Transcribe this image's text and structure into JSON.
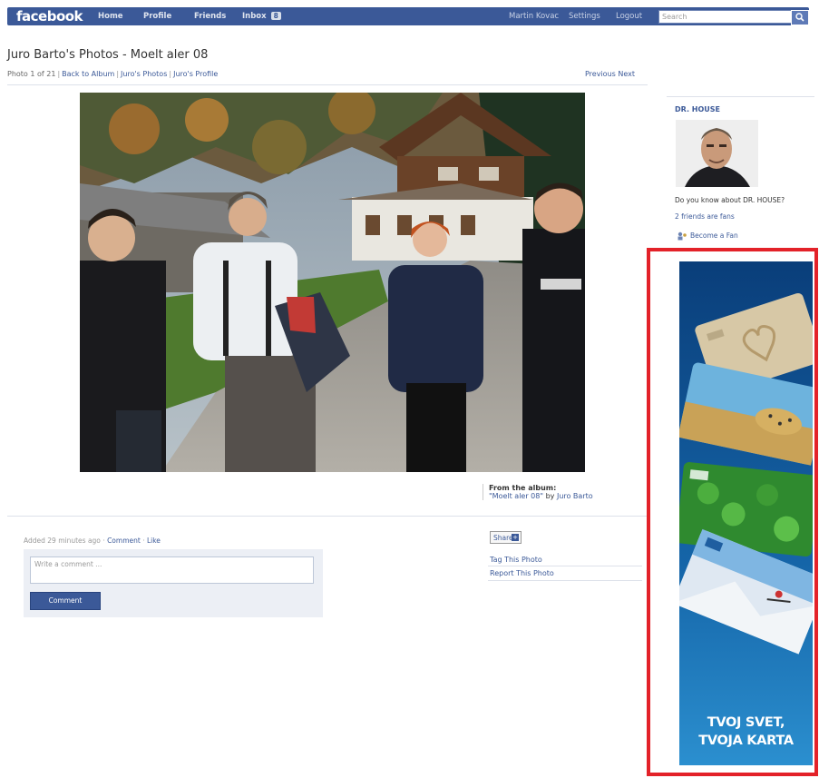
{
  "topbar": {
    "logo": "facebook",
    "nav": [
      "Home",
      "Profile",
      "Friends",
      "Inbox"
    ],
    "inbox_count": "8",
    "user": "Martin Kovac",
    "settings": "Settings",
    "logout": "Logout",
    "search_placeholder": "Search"
  },
  "page": {
    "title": "Juro Barto's Photos - Moelt aler 08",
    "photo_index": "Photo 1 of 21",
    "back_to_album": "Back to Album",
    "owner_photos": "Juro's Photos",
    "owner_profile": "Juro's Profile",
    "previous": "Previous",
    "next": "Next"
  },
  "album": {
    "label": "From the album:",
    "name": "\"Moelt aler 08\"",
    "by": "by",
    "owner": "Juro Barto"
  },
  "comments": {
    "added_text": "Added 29 minutes ago",
    "comment_link": "Comment",
    "like_link": "Like",
    "placeholder": "Write a comment ...",
    "button": "Comment"
  },
  "actions": {
    "share": "Share",
    "tag": "Tag This Photo",
    "report": "Report This Photo"
  },
  "fan_box": {
    "title": "DR. HOUSE",
    "question": "Do you know about DR. HOUSE?",
    "fans": "2 friends are fans",
    "become_fan": "Become a Fan"
  },
  "ad": {
    "line1": "TVOJ SVET,",
    "line2": "TVOJA KARTA"
  },
  "colors": {
    "brand_blue": "#3b5998",
    "highlight_red": "#e32229",
    "ad_blue": "#1d7fc0"
  }
}
